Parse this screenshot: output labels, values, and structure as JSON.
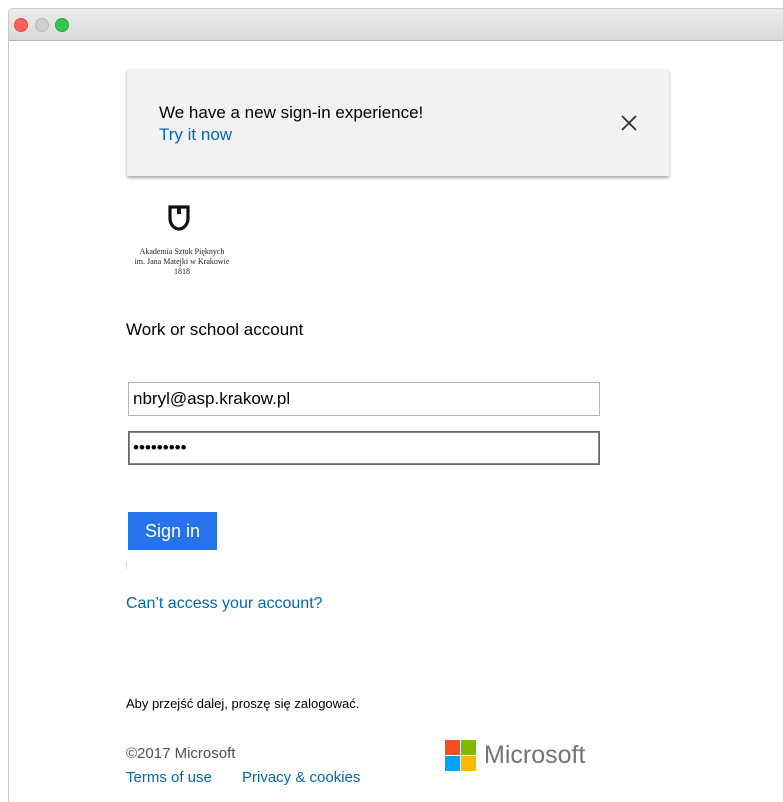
{
  "window": {
    "controls": [
      "close-button",
      "minimize-button",
      "zoom-button"
    ]
  },
  "banner": {
    "title": "We have a new sign-in experience!",
    "link": "Try it now",
    "close_icon": "close-icon"
  },
  "logo": {
    "icon": "shield-icon",
    "line1": "Akademia Sztuk Pięknych",
    "line2": "im. Jana Matejki w Krakowie",
    "line3": "1818"
  },
  "form": {
    "heading": "Work or school account",
    "email_value": "nbryl@asp.krakow.pl",
    "password_value": "•••••••••",
    "signin_label": "Sign in",
    "cant_access": "Can’t access your account?"
  },
  "note": "Aby przejść dalej, proszę się zalogować.",
  "footer": {
    "copyright": "©2017 Microsoft",
    "terms": "Terms of use",
    "privacy": "Privacy & cookies",
    "brand": "Microsoft",
    "brand_colors": [
      "#f25022",
      "#7fba00",
      "#00a4ef",
      "#ffb900"
    ]
  },
  "colors": {
    "link": "#0067b8",
    "button": "#2672ec"
  }
}
